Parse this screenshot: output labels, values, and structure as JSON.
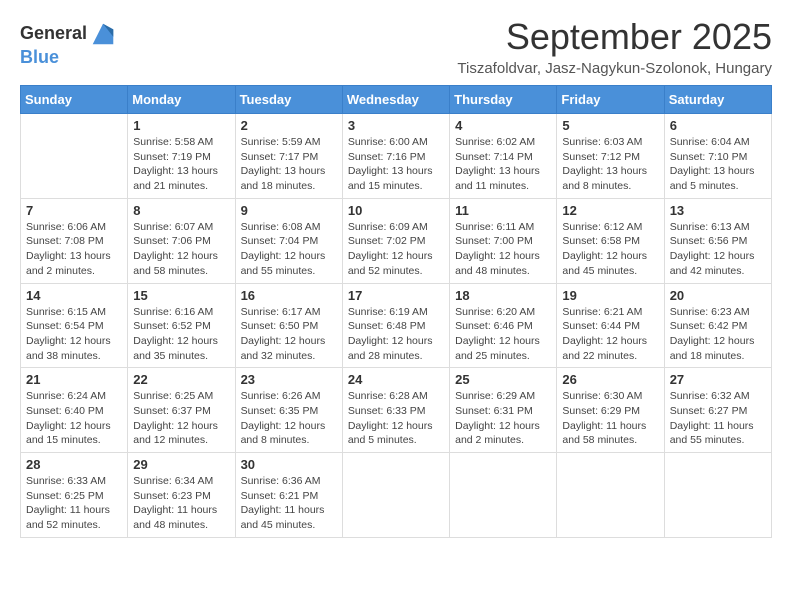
{
  "logo": {
    "general": "General",
    "blue": "Blue"
  },
  "title": "September 2025",
  "subtitle": "Tiszafoldvar, Jasz-Nagykun-Szolonok, Hungary",
  "days_of_week": [
    "Sunday",
    "Monday",
    "Tuesday",
    "Wednesday",
    "Thursday",
    "Friday",
    "Saturday"
  ],
  "weeks": [
    [
      {
        "day": "",
        "info": ""
      },
      {
        "day": "1",
        "info": "Sunrise: 5:58 AM\nSunset: 7:19 PM\nDaylight: 13 hours\nand 21 minutes."
      },
      {
        "day": "2",
        "info": "Sunrise: 5:59 AM\nSunset: 7:17 PM\nDaylight: 13 hours\nand 18 minutes."
      },
      {
        "day": "3",
        "info": "Sunrise: 6:00 AM\nSunset: 7:16 PM\nDaylight: 13 hours\nand 15 minutes."
      },
      {
        "day": "4",
        "info": "Sunrise: 6:02 AM\nSunset: 7:14 PM\nDaylight: 13 hours\nand 11 minutes."
      },
      {
        "day": "5",
        "info": "Sunrise: 6:03 AM\nSunset: 7:12 PM\nDaylight: 13 hours\nand 8 minutes."
      },
      {
        "day": "6",
        "info": "Sunrise: 6:04 AM\nSunset: 7:10 PM\nDaylight: 13 hours\nand 5 minutes."
      }
    ],
    [
      {
        "day": "7",
        "info": "Sunrise: 6:06 AM\nSunset: 7:08 PM\nDaylight: 13 hours\nand 2 minutes."
      },
      {
        "day": "8",
        "info": "Sunrise: 6:07 AM\nSunset: 7:06 PM\nDaylight: 12 hours\nand 58 minutes."
      },
      {
        "day": "9",
        "info": "Sunrise: 6:08 AM\nSunset: 7:04 PM\nDaylight: 12 hours\nand 55 minutes."
      },
      {
        "day": "10",
        "info": "Sunrise: 6:09 AM\nSunset: 7:02 PM\nDaylight: 12 hours\nand 52 minutes."
      },
      {
        "day": "11",
        "info": "Sunrise: 6:11 AM\nSunset: 7:00 PM\nDaylight: 12 hours\nand 48 minutes."
      },
      {
        "day": "12",
        "info": "Sunrise: 6:12 AM\nSunset: 6:58 PM\nDaylight: 12 hours\nand 45 minutes."
      },
      {
        "day": "13",
        "info": "Sunrise: 6:13 AM\nSunset: 6:56 PM\nDaylight: 12 hours\nand 42 minutes."
      }
    ],
    [
      {
        "day": "14",
        "info": "Sunrise: 6:15 AM\nSunset: 6:54 PM\nDaylight: 12 hours\nand 38 minutes."
      },
      {
        "day": "15",
        "info": "Sunrise: 6:16 AM\nSunset: 6:52 PM\nDaylight: 12 hours\nand 35 minutes."
      },
      {
        "day": "16",
        "info": "Sunrise: 6:17 AM\nSunset: 6:50 PM\nDaylight: 12 hours\nand 32 minutes."
      },
      {
        "day": "17",
        "info": "Sunrise: 6:19 AM\nSunset: 6:48 PM\nDaylight: 12 hours\nand 28 minutes."
      },
      {
        "day": "18",
        "info": "Sunrise: 6:20 AM\nSunset: 6:46 PM\nDaylight: 12 hours\nand 25 minutes."
      },
      {
        "day": "19",
        "info": "Sunrise: 6:21 AM\nSunset: 6:44 PM\nDaylight: 12 hours\nand 22 minutes."
      },
      {
        "day": "20",
        "info": "Sunrise: 6:23 AM\nSunset: 6:42 PM\nDaylight: 12 hours\nand 18 minutes."
      }
    ],
    [
      {
        "day": "21",
        "info": "Sunrise: 6:24 AM\nSunset: 6:40 PM\nDaylight: 12 hours\nand 15 minutes."
      },
      {
        "day": "22",
        "info": "Sunrise: 6:25 AM\nSunset: 6:37 PM\nDaylight: 12 hours\nand 12 minutes."
      },
      {
        "day": "23",
        "info": "Sunrise: 6:26 AM\nSunset: 6:35 PM\nDaylight: 12 hours\nand 8 minutes."
      },
      {
        "day": "24",
        "info": "Sunrise: 6:28 AM\nSunset: 6:33 PM\nDaylight: 12 hours\nand 5 minutes."
      },
      {
        "day": "25",
        "info": "Sunrise: 6:29 AM\nSunset: 6:31 PM\nDaylight: 12 hours\nand 2 minutes."
      },
      {
        "day": "26",
        "info": "Sunrise: 6:30 AM\nSunset: 6:29 PM\nDaylight: 11 hours\nand 58 minutes."
      },
      {
        "day": "27",
        "info": "Sunrise: 6:32 AM\nSunset: 6:27 PM\nDaylight: 11 hours\nand 55 minutes."
      }
    ],
    [
      {
        "day": "28",
        "info": "Sunrise: 6:33 AM\nSunset: 6:25 PM\nDaylight: 11 hours\nand 52 minutes."
      },
      {
        "day": "29",
        "info": "Sunrise: 6:34 AM\nSunset: 6:23 PM\nDaylight: 11 hours\nand 48 minutes."
      },
      {
        "day": "30",
        "info": "Sunrise: 6:36 AM\nSunset: 6:21 PM\nDaylight: 11 hours\nand 45 minutes."
      },
      {
        "day": "",
        "info": ""
      },
      {
        "day": "",
        "info": ""
      },
      {
        "day": "",
        "info": ""
      },
      {
        "day": "",
        "info": ""
      }
    ]
  ]
}
